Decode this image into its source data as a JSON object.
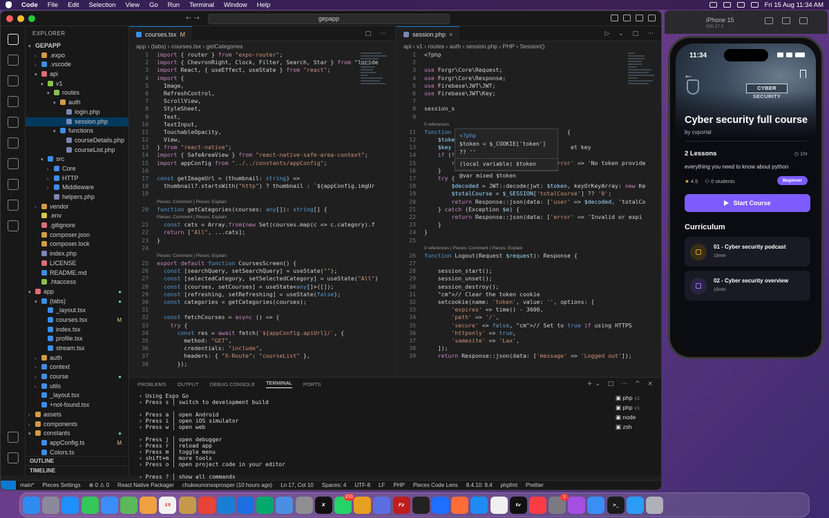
{
  "menubar": {
    "app": "Code",
    "items": [
      "File",
      "Edit",
      "Selection",
      "View",
      "Go",
      "Run",
      "Terminal",
      "Window",
      "Help"
    ],
    "datetime": "Fri 15 Aug  11:34 AM"
  },
  "titlebar": {
    "search": "gepapp",
    "nav": "←  →"
  },
  "explorer": {
    "title": "EXPLORER",
    "root": "GEPAPP",
    "outline": "OUTLINE",
    "timeline": "TIMELINE",
    "tree": [
      {
        "label": "GEPAPP",
        "indent": 0,
        "chev": "▾",
        "root": true
      },
      {
        "label": ".expo",
        "indent": 1,
        "chev": "›",
        "color": "#d39b43"
      },
      {
        "label": ".vscode",
        "indent": 1,
        "chev": "›",
        "color": "#3b8eea"
      },
      {
        "label": "api",
        "indent": 1,
        "chev": "▾",
        "color": "#e06c75"
      },
      {
        "label": "v1",
        "indent": 2,
        "chev": "▾",
        "color": "#8bc34a"
      },
      {
        "label": "routes",
        "indent": 3,
        "chev": "▾",
        "color": "#8bc34a"
      },
      {
        "label": "auth",
        "indent": 4,
        "chev": "▾",
        "color": "#d39b43"
      },
      {
        "label": "login.php",
        "indent": 5,
        "chev": "",
        "color": "#7a86b8"
      },
      {
        "label": "session.php",
        "indent": 5,
        "chev": "",
        "color": "#7a86b8",
        "sel": true
      },
      {
        "label": "functions",
        "indent": 4,
        "chev": "▾",
        "color": "#3b8eea"
      },
      {
        "label": "courseDetails.php",
        "indent": 5,
        "chev": "",
        "color": "#7a86b8"
      },
      {
        "label": "courseList.php",
        "indent": 5,
        "chev": "",
        "color": "#7a86b8"
      },
      {
        "label": "src",
        "indent": 2,
        "chev": "▾",
        "color": "#3b8eea"
      },
      {
        "label": "Core",
        "indent": 3,
        "chev": "›",
        "color": "#3b8eea"
      },
      {
        "label": "HTTP",
        "indent": 3,
        "chev": "›",
        "color": "#3b8eea"
      },
      {
        "label": "Middleware",
        "indent": 3,
        "chev": "›",
        "color": "#3b8eea"
      },
      {
        "label": "helpers.php",
        "indent": 3,
        "chev": "",
        "color": "#7a86b8"
      },
      {
        "label": "vendor",
        "indent": 1,
        "chev": "›",
        "color": "#d39b43"
      },
      {
        "label": ".env",
        "indent": 1,
        "chev": "",
        "color": "#d8c74a"
      },
      {
        "label": ".gitignore",
        "indent": 1,
        "chev": "",
        "color": "#e06c75"
      },
      {
        "label": "composer.json",
        "indent": 1,
        "chev": "",
        "color": "#d39b43"
      },
      {
        "label": "composer.lock",
        "indent": 1,
        "chev": "",
        "color": "#d39b43"
      },
      {
        "label": "index.php",
        "indent": 1,
        "chev": "",
        "color": "#7a86b8"
      },
      {
        "label": "LICENSE",
        "indent": 1,
        "chev": "",
        "color": "#e06c75"
      },
      {
        "label": "README.md",
        "indent": 1,
        "chev": "",
        "color": "#3b8eea"
      },
      {
        "label": ".htaccess",
        "indent": 1,
        "chev": "",
        "color": "#8bc34a"
      },
      {
        "label": "app",
        "indent": 0,
        "chev": "▾",
        "color": "#e06c75",
        "dot": true
      },
      {
        "label": "(tabs)",
        "indent": 1,
        "chev": "▾",
        "color": "#3b8eea",
        "dot": true
      },
      {
        "label": "_layout.tsx",
        "indent": 2,
        "chev": "",
        "color": "#3b8eea"
      },
      {
        "label": "courses.tsx",
        "indent": 2,
        "chev": "",
        "color": "#3b8eea",
        "mark": "M"
      },
      {
        "label": "index.tsx",
        "indent": 2,
        "chev": "",
        "color": "#3b8eea"
      },
      {
        "label": "profile.tsx",
        "indent": 2,
        "chev": "",
        "color": "#3b8eea"
      },
      {
        "label": "stream.tsx",
        "indent": 2,
        "chev": "",
        "color": "#3b8eea"
      },
      {
        "label": "auth",
        "indent": 1,
        "chev": "›",
        "color": "#d39b43"
      },
      {
        "label": "context",
        "indent": 1,
        "chev": "›",
        "color": "#3b8eea"
      },
      {
        "label": "course",
        "indent": 1,
        "chev": "›",
        "color": "#3b8eea",
        "dot": true
      },
      {
        "label": "utils",
        "indent": 1,
        "chev": "›",
        "color": "#3b8eea"
      },
      {
        "label": "_layout.tsx",
        "indent": 1,
        "chev": "",
        "color": "#3b8eea"
      },
      {
        "label": "+not-found.tsx",
        "indent": 1,
        "chev": "",
        "color": "#3b8eea"
      },
      {
        "label": "assets",
        "indent": 0,
        "chev": "›",
        "color": "#d39b43"
      },
      {
        "label": "components",
        "indent": 0,
        "chev": "›",
        "color": "#d39b43"
      },
      {
        "label": "constants",
        "indent": 0,
        "chev": "▾",
        "color": "#d39b43",
        "dot": true
      },
      {
        "label": "appConfig.ts",
        "indent": 1,
        "chev": "",
        "color": "#3b8eea",
        "mark": "M"
      },
      {
        "label": "Colors.ts",
        "indent": 1,
        "chev": "",
        "color": "#3b8eea"
      }
    ]
  },
  "editor_left": {
    "tab": "courses.tsx",
    "tab_mark": "M",
    "breadcrumb": "app › (tabs) › courses.tsx › getCategories",
    "lines": [
      {
        "n": "1",
        "t": "import { router } from \"expo-router\";"
      },
      {
        "n": "2",
        "t": "import { ChevronRight, Clock, Filter, Search, Star } from \"lucide"
      },
      {
        "n": "3",
        "t": "import React, { useEffect, useState } from \"react\";"
      },
      {
        "n": "4",
        "t": "import {"
      },
      {
        "n": "5",
        "t": "  Image,"
      },
      {
        "n": "6",
        "t": "  RefreshControl,"
      },
      {
        "n": "7",
        "t": "  ScrollView,"
      },
      {
        "n": "8",
        "t": "  StyleSheet,"
      },
      {
        "n": "9",
        "t": "  Text,"
      },
      {
        "n": "10",
        "t": "  TextInput,"
      },
      {
        "n": "11",
        "t": "  TouchableOpacity,"
      },
      {
        "n": "12",
        "t": "  View,"
      },
      {
        "n": "13",
        "t": "} from \"react-native\";"
      },
      {
        "n": "14",
        "t": "import { SafeAreaView } from \"react-native-safe-area-context\";"
      },
      {
        "n": "15",
        "t": "import appConfig from \"../../constants/appConfig\";"
      },
      {
        "n": "16",
        "t": ""
      },
      {
        "n": "17",
        "t": "const getImageUrl = (thumbnail: string) =>"
      },
      {
        "n": "18",
        "t": "  thumbnail?.startsWith(\"http\") ? thumbnail : `${appConfig.imgUr"
      },
      {
        "n": "19",
        "t": ""
      },
      {
        "n": "",
        "t": "Pieces: Comment | Pieces: Explain",
        "lens": true
      },
      {
        "n": "20",
        "t": "function getCategories(courses: any[]): string[] {"
      },
      {
        "n": "",
        "t": "Pieces: Comment | Pieces: Explain",
        "lens": true
      },
      {
        "n": "21",
        "t": "  const cats = Array.from(new Set(courses.map(c => c.category).f"
      },
      {
        "n": "22",
        "t": "  return [\"All\", ...cats];"
      },
      {
        "n": "23",
        "t": "}"
      },
      {
        "n": "24",
        "t": ""
      },
      {
        "n": "",
        "t": "Pieces: Comment | Pieces: Explain",
        "lens": true
      },
      {
        "n": "25",
        "t": "export default function CoursesScreen() {"
      },
      {
        "n": "26",
        "t": "  const [searchQuery, setSearchQuery] = useState(\"\");"
      },
      {
        "n": "27",
        "t": "  const [selectedCategory, setSelectedCategory] = useState(\"All\")"
      },
      {
        "n": "28",
        "t": "  const [courses, setCourses] = useState<any[]>([]);"
      },
      {
        "n": "29",
        "t": "  const [refreshing, setRefreshing] = useState(false);"
      },
      {
        "n": "30",
        "t": "  const categories = getCategories(courses);"
      },
      {
        "n": "31",
        "t": ""
      },
      {
        "n": "32",
        "t": "  const fetchCourses = async () => {"
      },
      {
        "n": "33",
        "t": "    try {"
      },
      {
        "n": "34",
        "t": "      const res = await fetch(`${appConfig.apiUrl}/`, {"
      },
      {
        "n": "35",
        "t": "        method: \"GET\","
      },
      {
        "n": "36",
        "t": "        credentials: \"include\","
      },
      {
        "n": "37",
        "t": "        headers: { \"X-Route\": \"courseList\" },"
      },
      {
        "n": "38",
        "t": "      });"
      }
    ]
  },
  "editor_right": {
    "tab": "session.php",
    "breadcrumb": "api › v1 › routes › auth › session.php › PHP › Session()",
    "lines": [
      {
        "n": "1",
        "t": "<?php"
      },
      {
        "n": "2",
        "t": ""
      },
      {
        "n": "3",
        "t": "use Forgr\\Core\\Request;"
      },
      {
        "n": "4",
        "t": "use Forgr\\Core\\Response;"
      },
      {
        "n": "5",
        "t": "use Firebase\\JWT\\JWT;"
      },
      {
        "n": "6",
        "t": "use Firebase\\JWT\\Key;"
      },
      {
        "n": "7",
        "t": ""
      },
      {
        "n": "8",
        "t": "session_s"
      },
      {
        "n": "9",
        "t": ""
      },
      {
        "n": "",
        "t": "0 references",
        "lens": true
      },
      {
        "n": "11",
        "t": "function                                  {"
      },
      {
        "n": "12",
        "t": "    $toke"
      },
      {
        "n": "13",
        "t": "    $key                                   et key"
      },
      {
        "n": "14",
        "t": "    if (!$token) {"
      },
      {
        "n": "15",
        "t": "        return Response::json(data: ['error' => 'No token provide"
      },
      {
        "n": "16",
        "t": "    }"
      },
      {
        "n": "17",
        "t": "    try {"
      },
      {
        "n": "18",
        "t": "        $decoded = JWT::decode(jwt: $token, keyOrKeyArray: new Ke"
      },
      {
        "n": "19",
        "t": "        $totalCourse = $_SESSION['totalCourse'] ?? '0';"
      },
      {
        "n": "20",
        "t": "        return Response::json(data: ['user' => $decoded, 'totalCo"
      },
      {
        "n": "21",
        "t": "    } catch (Exception $e) {"
      },
      {
        "n": "22",
        "t": "        return Response::json(data: ['error' => 'Invalid or expi"
      },
      {
        "n": "23",
        "t": "    }"
      },
      {
        "n": "24",
        "t": "}"
      },
      {
        "n": "25",
        "t": ""
      },
      {
        "n": "",
        "t": "0 references | Pieces: Comment | Pieces: Explain",
        "lens": true
      },
      {
        "n": "26",
        "t": "function Logout(Request $request): Response {"
      },
      {
        "n": "27",
        "t": ""
      },
      {
        "n": "28",
        "t": "    session_start();"
      },
      {
        "n": "29",
        "t": "    session_unset();"
      },
      {
        "n": "30",
        "t": "    session_destroy();"
      },
      {
        "n": "31",
        "t": "    // Clear the token cookie"
      },
      {
        "n": "32",
        "t": "    setcookie(name: 'token', value: '', options: ["
      },
      {
        "n": "33",
        "t": "        'expires' => time() - 3600,"
      },
      {
        "n": "34",
        "t": "        'path' => '/',"
      },
      {
        "n": "35",
        "t": "        'secure' => false, // Set to true if using HTTPS"
      },
      {
        "n": "36",
        "t": "        'httponly' => true,"
      },
      {
        "n": "37",
        "t": "        'samesite' => 'Lax',"
      },
      {
        "n": "38",
        "t": "    ]);"
      },
      {
        "n": "39",
        "t": "    return Response::json(data: ['message' => 'Logged out']);"
      }
    ],
    "hover": {
      "l1": "<?php",
      "l2": "$token = $_COOKIE['token'] ?? ''",
      "l3": "(local variable) $token",
      "l4": "@var mixed $token"
    }
  },
  "panel": {
    "tabs": [
      "PROBLEMS",
      "OUTPUT",
      "DEBUG CONSOLE",
      "TERMINAL",
      "PORTS"
    ],
    "active": "TERMINAL",
    "terminal": [
      "› Using Expo Go",
      "› Press s │ switch to development build",
      "",
      "› Press a │ open Android",
      "› Press i │ open iOS simulator",
      "› Press w │ open web",
      "",
      "› Press j │ open debugger",
      "› Press r │ reload app",
      "› Press m │ toggle menu",
      "› shift+m │ more tools",
      "› Press o │ open project code in your editor",
      "",
      "› Press ? │ show all commands",
      "",
      "▯"
    ],
    "term_list": [
      {
        "name": "php",
        "v": "v1"
      },
      {
        "name": "php",
        "v": "v1"
      },
      {
        "name": "node",
        "v": ""
      },
      {
        "name": "zsh",
        "v": ""
      }
    ]
  },
  "statusbar": {
    "items": [
      "main*",
      "Pieces Settings",
      "⊗ 0 ⚠ 0",
      "React Native Packager",
      "chukwunonsoprosper (10 hours ago)",
      "Ln 17, Col 10",
      "Spaces: 4",
      "UTF-8",
      "LF",
      "PHP",
      "Pieces Code Lens",
      "8.4.10: 8.4",
      "phpfmt",
      "Prettier"
    ]
  },
  "simulator": {
    "device": "iPhone 15",
    "os": "iOS 17.2"
  },
  "phone": {
    "time": "11:34",
    "hero_text": "CYBER SECURITY",
    "course_title": "Cyber security full course",
    "author": "by cvportal",
    "lessons": "2 Lessons",
    "duration": "1hr",
    "description": "everything you need to know about python",
    "rating": "4.5",
    "students": "0 students",
    "level": "Beginner",
    "start": "Start Course",
    "curriculum": "Curriculum",
    "items": [
      {
        "title": "01 - Cyber security podcast",
        "sub": "15min",
        "color": "#e0a030",
        "bg": "#3a2e18"
      },
      {
        "title": "02 - Cyber security overview",
        "sub": "15min",
        "color": "#9b7cff",
        "bg": "#2a2440"
      }
    ]
  },
  "dock": {
    "items": [
      {
        "name": "finder",
        "c": "#2d8cf0"
      },
      {
        "name": "launchpad",
        "c": "#8a8a9a"
      },
      {
        "name": "safari",
        "c": "#1e90ff"
      },
      {
        "name": "messages",
        "c": "#34c759"
      },
      {
        "name": "mail",
        "c": "#3a8ef6"
      },
      {
        "name": "maps",
        "c": "#5bb85b"
      },
      {
        "name": "photos",
        "c": "#f0a040"
      },
      {
        "name": "calendar",
        "c": "#f2f2f2",
        "label": "15"
      },
      {
        "name": "notes",
        "c": "#c69a4a"
      },
      {
        "name": "chrome",
        "c": "#e84335"
      },
      {
        "name": "vscode",
        "c": "#1a7fd4"
      },
      {
        "name": "xcode",
        "c": "#1c6fe0"
      },
      {
        "name": "meet",
        "c": "#00a86b"
      },
      {
        "name": "reminders",
        "c": "#4a90e2"
      },
      {
        "name": "settings",
        "c": "#8e8e93"
      },
      {
        "name": "x",
        "c": "#111111",
        "label": "X"
      },
      {
        "name": "whatsapp",
        "c": "#25d366",
        "badge": "233"
      },
      {
        "name": "proxyman",
        "c": "#e8a020"
      },
      {
        "name": "copilot",
        "c": "#5b6ee1"
      },
      {
        "name": "filezilla",
        "c": "#bf1e1e",
        "label": "Fz"
      },
      {
        "name": "threads",
        "c": "#222222"
      },
      {
        "name": "bluetooth",
        "c": "#1e6fff"
      },
      {
        "name": "postman",
        "c": "#ff6c37"
      },
      {
        "name": "appstore",
        "c": "#1c8cf5"
      },
      {
        "name": "freeform",
        "c": "#f0f0f0"
      },
      {
        "name": "appletv",
        "c": "#111111",
        "label": "tv"
      },
      {
        "name": "music",
        "c": "#fc3c44"
      },
      {
        "name": "prefs",
        "c": "#7a7a80",
        "badge": "1"
      },
      {
        "name": "podcast",
        "c": "#a44fe0"
      },
      {
        "name": "simulator",
        "c": "#3a8ef6"
      },
      {
        "name": "terminal",
        "c": "#1c1c1c",
        "label": ">_"
      },
      {
        "name": "downloads",
        "c": "#2a9df4"
      },
      {
        "name": "trash",
        "c": "#b0b0b8"
      }
    ]
  }
}
